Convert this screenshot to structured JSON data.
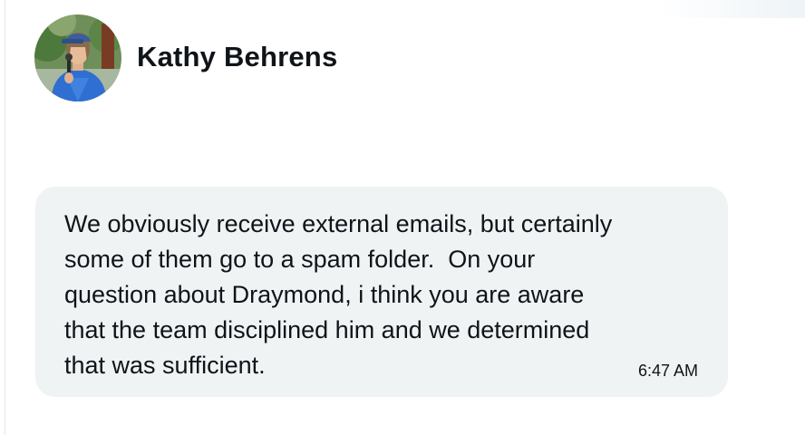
{
  "sender": {
    "name": "Kathy Behrens",
    "avatar_icon": "profile-photo"
  },
  "message": {
    "text": "We obviously receive external emails, but certainly\nsome of them go to a spam folder.  On your\nquestion about Draymond, i think you are aware\nthat the team disciplined him and we determined\nthat was sufficient.",
    "time": "6:47 AM"
  },
  "colors": {
    "bubble_background": "#eff3f4",
    "text": "#0f1419",
    "background": "#ffffff"
  }
}
